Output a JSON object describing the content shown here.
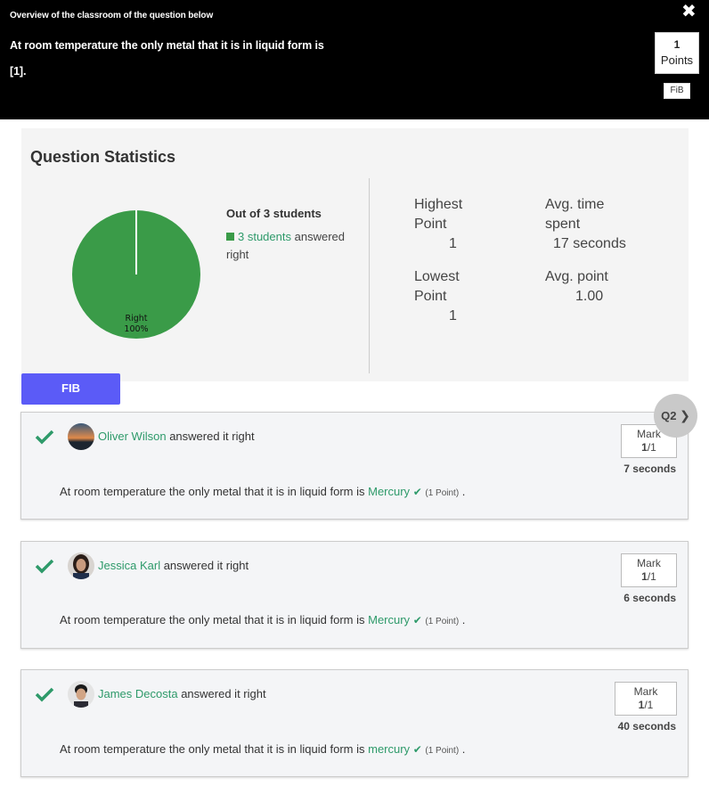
{
  "header": {
    "overview_label": "Overview of the classroom of the question below",
    "question_line1": "At room temperature the only metal that it is in liquid form is",
    "question_line2": "[1].",
    "close_glyph": "✖",
    "points_value": "1",
    "points_label": "Points",
    "type_badge": "FiB"
  },
  "stats": {
    "title": "Question Statistics",
    "out_of": "Out of 3 students",
    "answered_link": "3 students",
    "answered_rest": " answered right",
    "highest_label": "Highest Point",
    "highest_value": "1",
    "avg_time_label": "Avg. time spent",
    "avg_time_value": "17 seconds",
    "lowest_label": "Lowest Point",
    "lowest_value": "1",
    "avg_point_label": "Avg. point",
    "avg_point_value": "1.00"
  },
  "chart_data": {
    "type": "pie",
    "slices": [
      {
        "label": "Right",
        "value": 100,
        "display": "100%",
        "color": "#3a9b48"
      }
    ]
  },
  "fib_button": "FIB",
  "nav": {
    "next_label": "Q2",
    "next_icon": "chevron-right-icon"
  },
  "answers": [
    {
      "name": "Oliver Wilson",
      "suffix": " answered it right",
      "sentence": "At room temperature the only metal that it is in liquid form is",
      "answer": "Mercury",
      "points": "(1 Point)",
      "end": ".",
      "mark_label": "Mark",
      "mark_score": "1",
      "mark_total": "/1",
      "time": "7 seconds"
    },
    {
      "name": "Jessica Karl",
      "suffix": " answered it right",
      "sentence": "At room temperature the only metal that it is in liquid form is",
      "answer": "Mercury",
      "points": "(1 Point)",
      "end": ".",
      "mark_label": "Mark",
      "mark_score": "1",
      "mark_total": "/1",
      "time": "6 seconds"
    },
    {
      "name": "James Decosta",
      "suffix": " answered it right",
      "sentence": "At room temperature the only metal that it is in liquid form is",
      "answer": "mercury",
      "points": "(1 Point)",
      "end": ".",
      "mark_label": "Mark",
      "mark_score": "1",
      "mark_total": "/1",
      "time": "40 seconds"
    }
  ],
  "colors": {
    "accent_green": "#2e9a6a",
    "pie_green": "#3a9b48",
    "fib_button": "#5b5bf7"
  }
}
